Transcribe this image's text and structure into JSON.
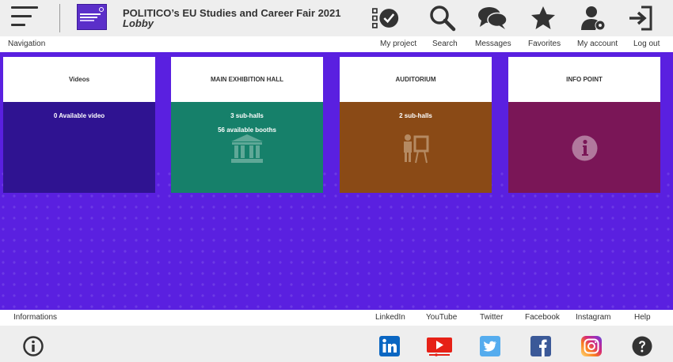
{
  "header": {
    "title": "POLITICO’s EU Studies and Career Fair 2021",
    "subtitle": "Lobby",
    "icons": [
      "hamburger-menu-icon",
      "event-logo",
      "checklist-icon",
      "search-icon",
      "messages-icon",
      "star-icon",
      "account-settings-icon",
      "logout-icon"
    ]
  },
  "nav": {
    "navigation_label": "Navigation",
    "my_project": "My project",
    "search": "Search",
    "messages": "Messages",
    "favorites": "Favorites",
    "my_account": "My account",
    "log_out": "Log out"
  },
  "cards": [
    {
      "title": "Videos",
      "line1": "0 Available video",
      "line2": "",
      "color": "#2f1391",
      "icon": ""
    },
    {
      "title": "MAIN EXHIBITION HALL",
      "line1": "3 sub-halls",
      "line2": "56 available booths",
      "color": "#16806a",
      "icon": "building-columns-icon"
    },
    {
      "title": "AUDITORIUM",
      "line1": "2 sub-halls",
      "line2": "",
      "color": "#8a4a16",
      "icon": "presentation-icon"
    },
    {
      "title": "INFO POINT",
      "line1": "",
      "line2": "",
      "color": "#7a1657",
      "icon": "info-icon"
    }
  ],
  "footer": {
    "informations": "Informations",
    "linkedin": "LinkedIn",
    "youtube": "YouTube",
    "twitter": "Twitter",
    "facebook": "Facebook",
    "instagram": "Instagram",
    "help": "Help"
  },
  "colors": {
    "background_purple": "#5a20e0",
    "header_gray": "#eeeeee",
    "linkedin": "#0a66c2",
    "youtube": "#e62117",
    "twitter": "#55acee",
    "facebook": "#3b5998"
  }
}
